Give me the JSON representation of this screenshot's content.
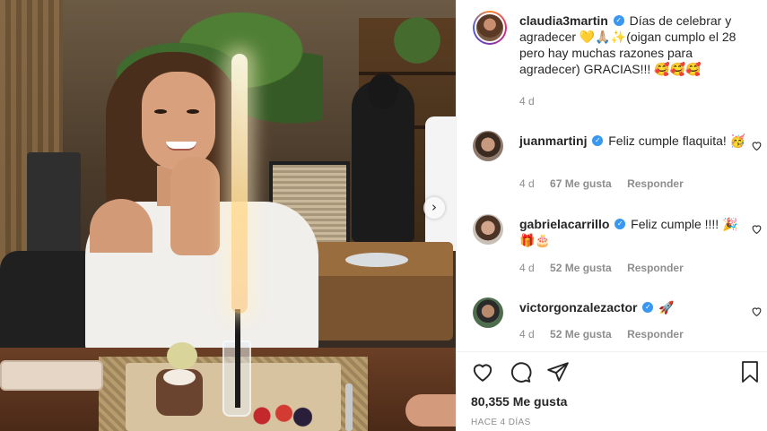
{
  "post": {
    "author": "claudia3martin",
    "caption": "Días de celebrar y agradecer 💛🙏🏼✨(oigan cumplo el 28 pero hay muchas razones para agradecer) GRACIAS!!! 🥰🥰🥰",
    "time": "4 d"
  },
  "comments": [
    {
      "user": "juanmartinj",
      "text": "Feliz cumple flaquita! 🥳",
      "time": "4 d",
      "likes": "67 Me gusta",
      "reply": "Responder",
      "avatar": "avatar-juanmartinj"
    },
    {
      "user": "gabrielacarrillo",
      "text": "Feliz cumple !!!! 🎉🎁🎂",
      "time": "4 d",
      "likes": "52 Me gusta",
      "reply": "Responder",
      "avatar": "avatar-gabrielacarrillo"
    },
    {
      "user": "victorgonzalezactor",
      "text": "🚀",
      "time": "4 d",
      "likes": "52 Me gusta",
      "reply": "Responder",
      "avatar": "avatar-victorgonzalezactor"
    }
  ],
  "actions": {
    "like_icon": "heart-icon",
    "comment_icon": "comment-icon",
    "share_icon": "paper-plane-icon",
    "save_icon": "bookmark-icon"
  },
  "likes_count": "80,355 Me gusta",
  "posted_ago": "HACE 4 DÍAS",
  "carousel_next": "›",
  "verified_mark": "✓",
  "colors": {
    "verified": "#3897f0",
    "muted": "#8e8e8e",
    "text": "#262626"
  }
}
